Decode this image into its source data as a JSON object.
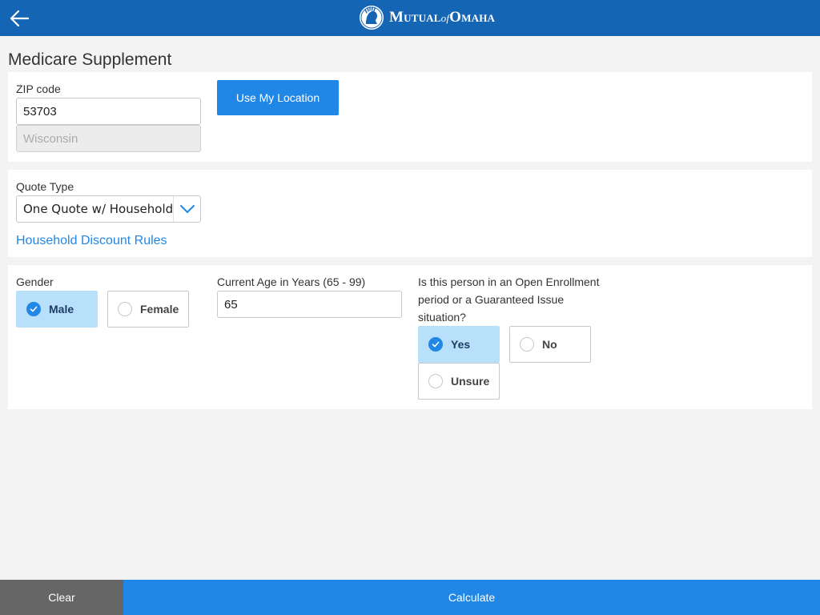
{
  "header": {
    "brand_mutual": "Mutual",
    "brand_of": "of",
    "brand_omaha": "Omaha",
    "bar_color": "#1565b5",
    "back_icon": "arrow-left-icon",
    "logo_icon": "indian-head-emblem-icon"
  },
  "page": {
    "title": "Medicare Supplement"
  },
  "location": {
    "zip_label": "ZIP code",
    "zip_value": "53703",
    "state_value": "Wisconsin",
    "use_location_label": "Use My Location"
  },
  "quote": {
    "type_label": "Quote Type",
    "type_value": "One Quote w/ Household",
    "dropdown_icon": "chevron-down-icon",
    "discount_rules_link": "Household Discount Rules"
  },
  "person": {
    "gender_label": "Gender",
    "gender_options": [
      {
        "label": "Male",
        "selected": true
      },
      {
        "label": "Female",
        "selected": false
      }
    ],
    "age_label": "Current Age in Years (65 - 99)",
    "age_value": "65",
    "enrollment_question": "Is this person in an Open Enrollment period or a Guaranteed Issue situation?",
    "enrollment_options": [
      {
        "label": "Yes",
        "selected": true
      },
      {
        "label": "No",
        "selected": false
      },
      {
        "label": "Unsure",
        "selected": false
      }
    ]
  },
  "footer": {
    "clear_label": "Clear",
    "calculate_label": "Calculate"
  },
  "colors": {
    "accent": "#2187e7",
    "selected_bg": "#b8e0fb",
    "clear_bg": "#666666"
  }
}
